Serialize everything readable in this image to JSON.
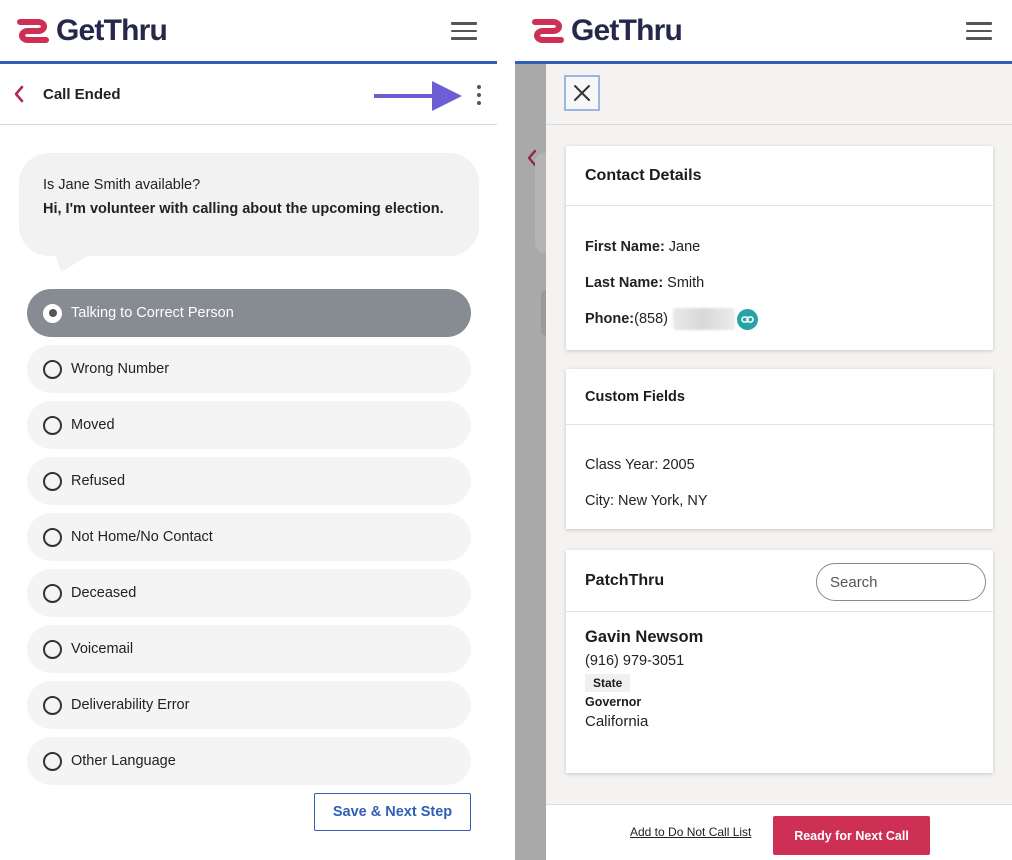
{
  "brand": {
    "name": "GetThru",
    "accent": "#cd2f55",
    "navy": "#252849",
    "blue": "#2f5fb6"
  },
  "left": {
    "header": {
      "title": "Call Ended",
      "back_icon": "chevron-left-icon",
      "menu_icon": "kebab-menu-icon",
      "annotation": "arrow-right-icon"
    },
    "script": {
      "question": "Is Jane Smith available?",
      "line": "Hi, I'm volunteer with calling about the upcoming election."
    },
    "options": [
      {
        "label": "Talking to Correct Person",
        "selected": true
      },
      {
        "label": "Wrong Number",
        "selected": false
      },
      {
        "label": "Moved",
        "selected": false
      },
      {
        "label": "Refused",
        "selected": false
      },
      {
        "label": "Not Home/No Contact",
        "selected": false
      },
      {
        "label": "Deceased",
        "selected": false
      },
      {
        "label": "Voicemail",
        "selected": false
      },
      {
        "label": "Deliverability Error",
        "selected": false
      },
      {
        "label": "Other Language",
        "selected": false
      }
    ],
    "save_label": "Save & Next Step"
  },
  "right": {
    "contact": {
      "title": "Contact Details",
      "first_label": "First Name:",
      "first_value": "Jane",
      "last_label": "Last Name:",
      "last_value": "Smith",
      "phone_label": "Phone:",
      "phone_area": "(858)"
    },
    "custom": {
      "title": "Custom Fields",
      "fields": [
        "Class Year: 2005",
        "City: New York, NY"
      ]
    },
    "patchthru": {
      "title": "PatchThru",
      "search_placeholder": "Search",
      "name": "Gavin Newsom",
      "phone": "(916) 979-3051",
      "badge": "State",
      "role": "Governor",
      "location": "California"
    },
    "footer": {
      "dnc_label": "Add to Do Not Call List",
      "ready_label": "Ready for Next Call"
    }
  }
}
